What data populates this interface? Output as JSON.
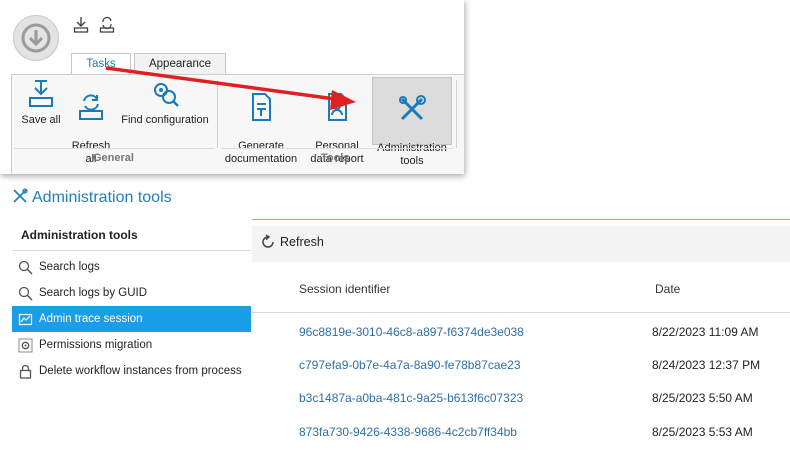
{
  "ribbon": {
    "tabs": [
      "Tasks",
      "Appearance"
    ],
    "groups": {
      "general": {
        "label": "General",
        "buttons": [
          "Save all",
          "Refresh\nall",
          "Find configuration"
        ]
      },
      "tools": {
        "label": "Tools",
        "buttons": [
          "Generate\ndocumentation",
          "Personal\ndata report",
          "Administration\ntools"
        ]
      }
    }
  },
  "page": {
    "title": "Administration tools"
  },
  "nav": {
    "header": "Administration tools",
    "items": [
      {
        "label": "Search logs",
        "icon": "search-icon"
      },
      {
        "label": "Search logs by GUID",
        "icon": "search-icon"
      },
      {
        "label": "Admin trace session",
        "icon": "trace-icon"
      },
      {
        "label": "Permissions migration",
        "icon": "gear-icon"
      },
      {
        "label": "Delete workflow instances from process",
        "icon": "lock-icon"
      }
    ]
  },
  "toolbar": {
    "refresh_label": "Refresh"
  },
  "table": {
    "columns": [
      "Session identifier",
      "Date"
    ],
    "rows": [
      {
        "session": "96c8819e-3010-46c8-a897-f6374de3e038",
        "date": "8/22/2023 11:09 AM"
      },
      {
        "session": "c797efa9-0b7e-4a7a-8a90-fe78b87cae23",
        "date": "8/24/2023 12:37 PM"
      },
      {
        "session": "b3c1487a-a0ba-481c-9a25-b613f6c07323",
        "date": "8/25/2023 5:50 AM"
      },
      {
        "session": "873fa730-9426-4338-9686-4c2cb7ff34bb",
        "date": "8/25/2023 5:53 AM"
      }
    ]
  },
  "colors": {
    "accent": "#1f7fc1",
    "selection": "#1a9ee8",
    "annotation_arrow": "#e02020"
  }
}
